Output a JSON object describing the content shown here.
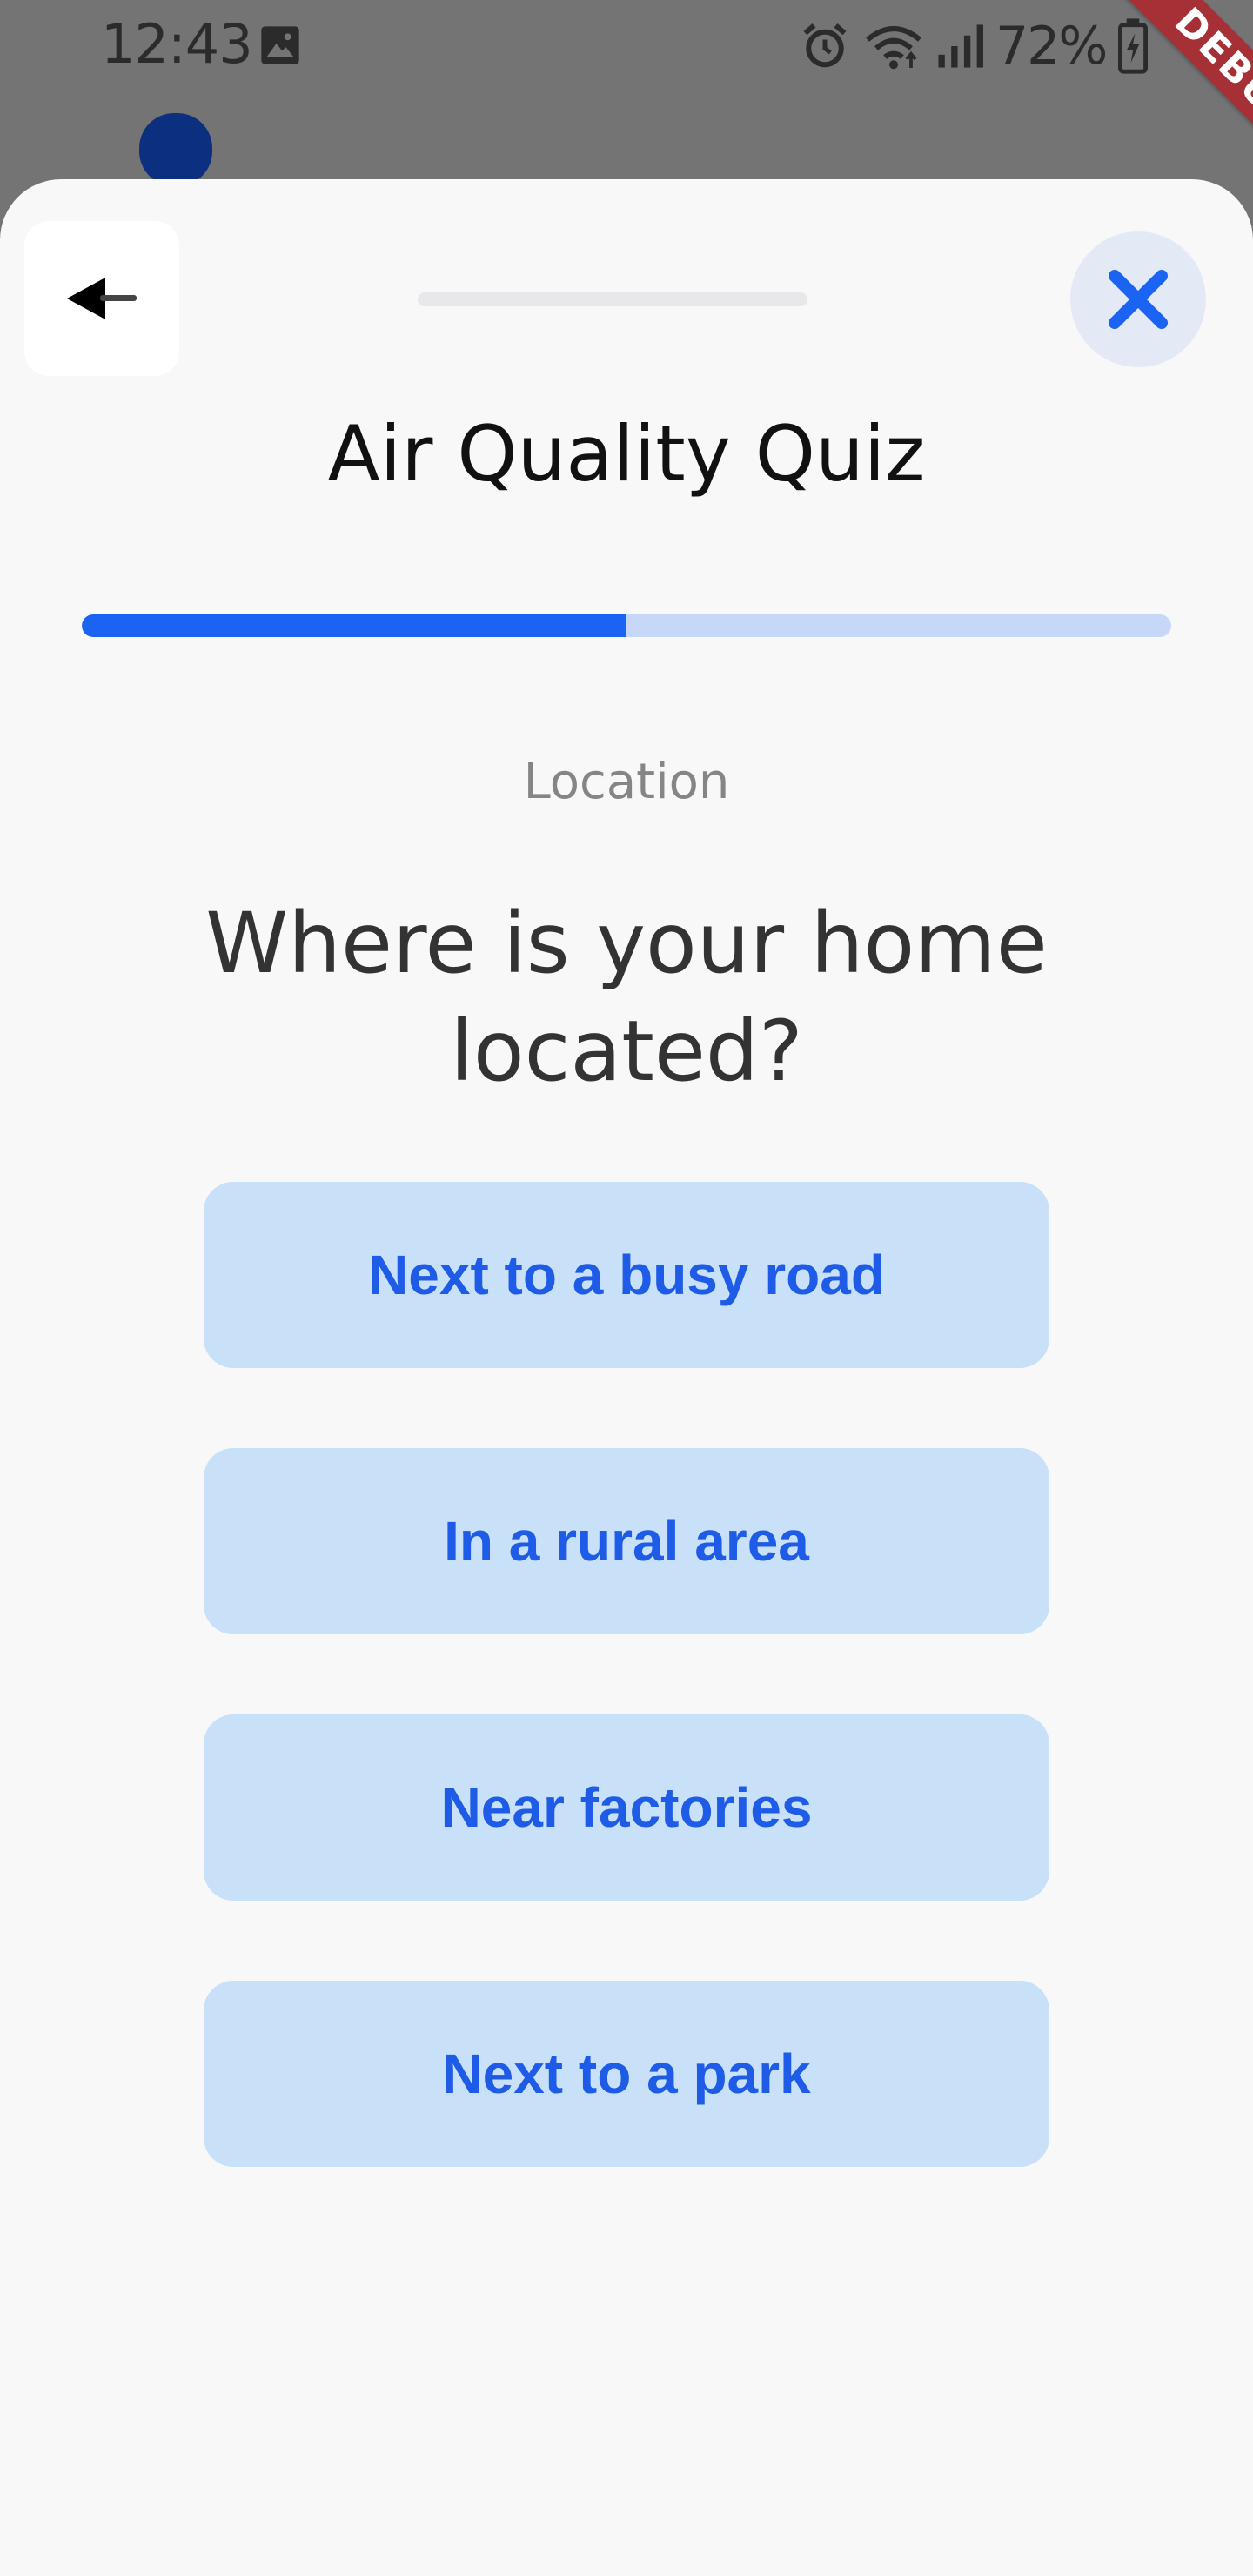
{
  "status_bar": {
    "time": "12:43",
    "battery_percent": "72%",
    "icons": [
      "gallery-icon",
      "alarm-icon",
      "wifi-icon",
      "signal-icon",
      "battery-charging-icon"
    ]
  },
  "debug_banner": "DEBUG",
  "header": {
    "back_icon": "arrow-left-icon",
    "close_icon": "close-x-icon",
    "title": "Air Quality Quiz"
  },
  "progress": {
    "fraction": 0.5
  },
  "question": {
    "category": "Location",
    "text": "Where is your home located?"
  },
  "answers": [
    {
      "label": "Next to a busy road"
    },
    {
      "label": "In a rural area"
    },
    {
      "label": "Near factories"
    },
    {
      "label": "Next to a park"
    }
  ],
  "colors": {
    "accent": "#1a63f3",
    "progress_track": "#c6d7f7",
    "answer_bg": "#c8e1f8",
    "answer_text": "#1e5be6",
    "sheet_bg": "#f8f8f9",
    "close_bg": "#e4e9f6",
    "debug_banner": "#a53036"
  }
}
